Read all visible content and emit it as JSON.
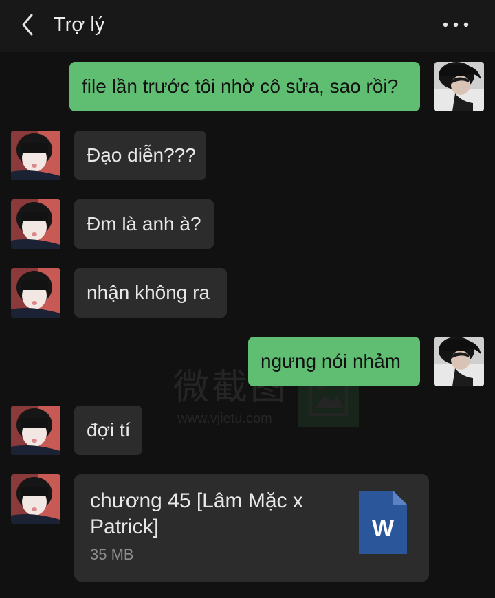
{
  "header": {
    "title": "Trợ lý",
    "back_icon": "chevron-left-icon",
    "more_icon": "more-horizontal-icon"
  },
  "messages": [
    {
      "sender": "me",
      "text": "file lần trước tôi nhờ cô sửa, sao rồi?"
    },
    {
      "sender": "assistant",
      "text": "Đạo diễn???"
    },
    {
      "sender": "assistant",
      "text": "Đm là anh à?"
    },
    {
      "sender": "assistant",
      "text": "nhận không ra"
    },
    {
      "sender": "me",
      "text": "ngưng nói nhảm"
    },
    {
      "sender": "assistant",
      "text": "đợi tí"
    }
  ],
  "file_message": {
    "sender": "assistant",
    "name": "chương 45 [Lâm Mặc x Patrick]",
    "size": "35 MB",
    "icon_letter": "W",
    "icon": "word-document-icon"
  },
  "watermark": {
    "text": "微截图",
    "url": "www.vjietu.com"
  },
  "colors": {
    "background": "#111111",
    "header": "#181818",
    "incoming_bubble": "#2c2c2c",
    "outgoing_bubble": "#5fbe72",
    "word_icon": "#2b579a"
  }
}
